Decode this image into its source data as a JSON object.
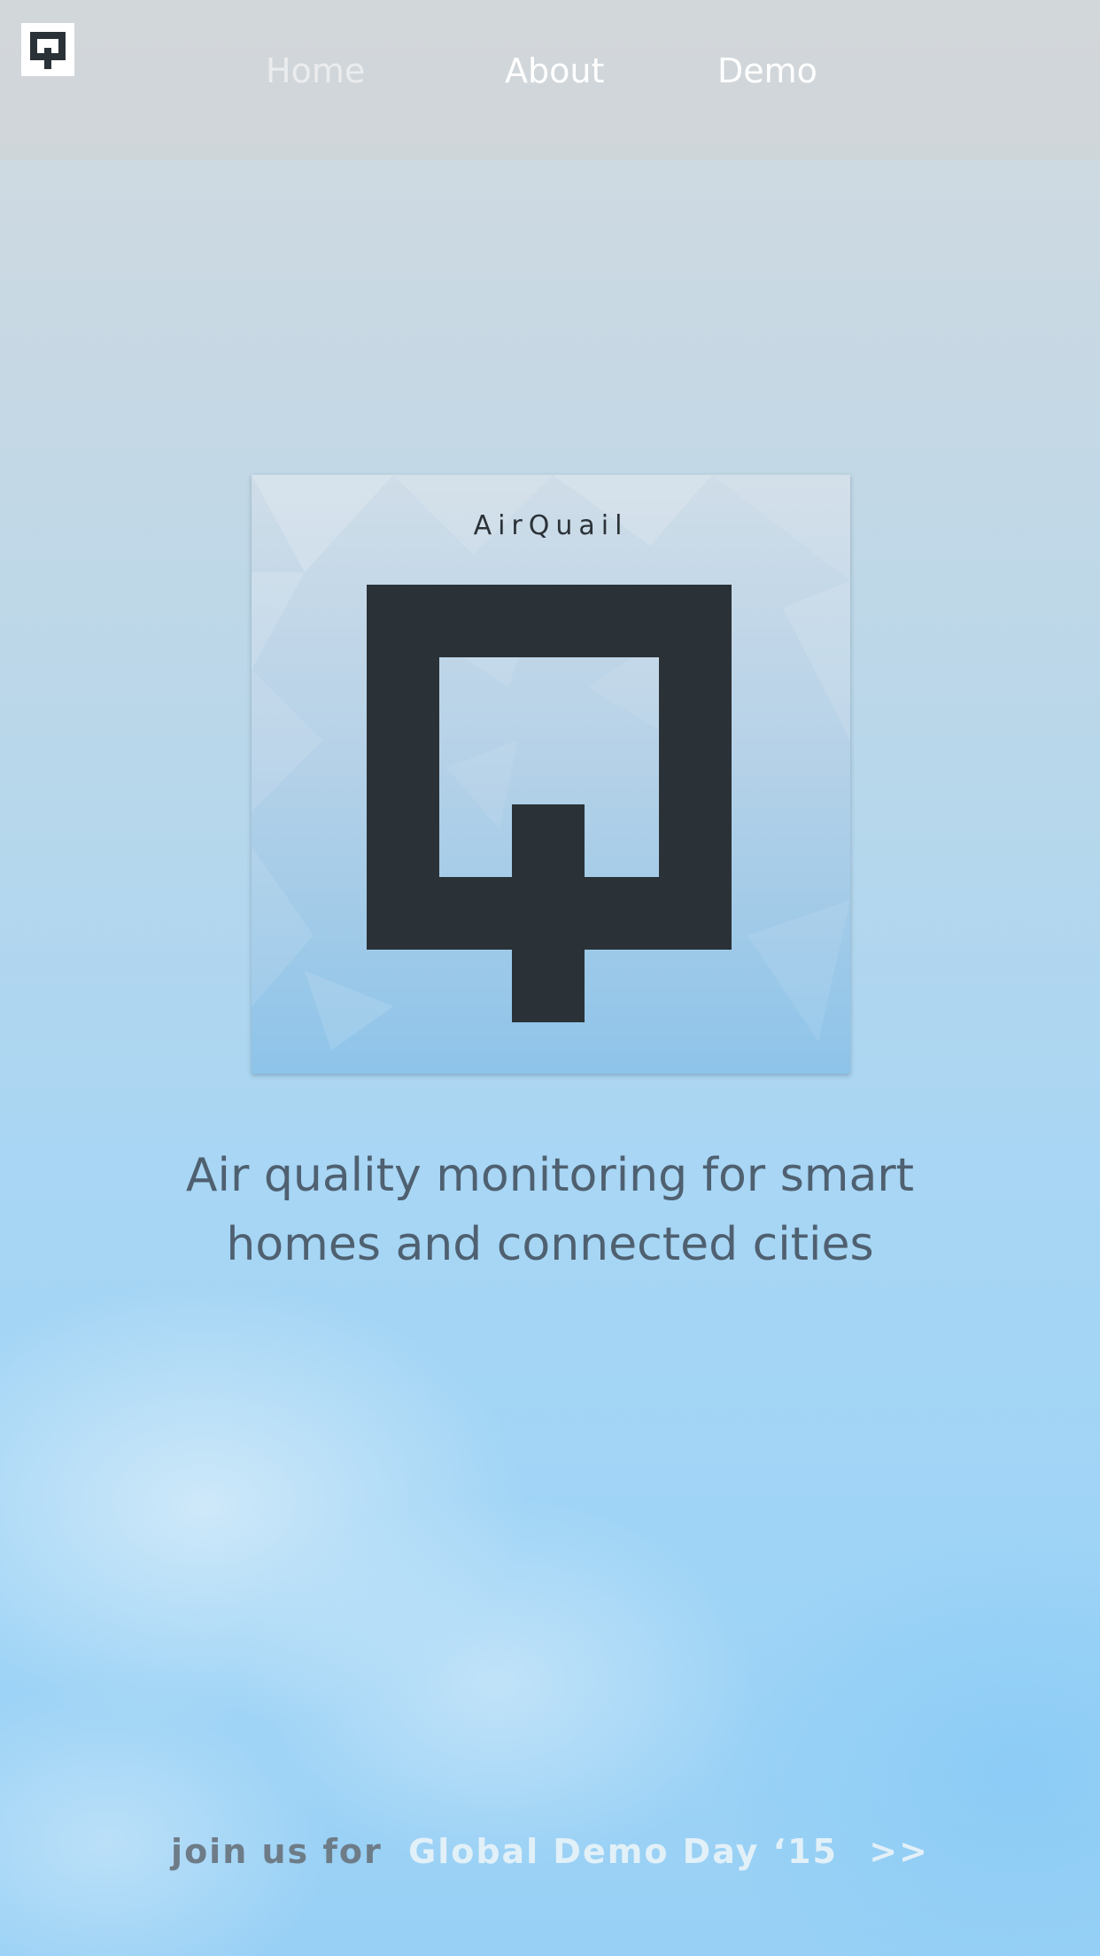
{
  "nav": {
    "logo_icon": "airquail-q-icon",
    "items": [
      {
        "label": "Home",
        "active": true
      },
      {
        "label": "About",
        "active": false
      },
      {
        "label": "Demo",
        "active": false
      }
    ]
  },
  "hero": {
    "brand_name": "AirQuail",
    "logo_icon": "airquail-q-logo"
  },
  "tagline": {
    "line1": "Air quality monitoring for smart",
    "line2": "homes and connected cities"
  },
  "cta": {
    "prefix": "join us for",
    "link": "Global Demo Day ‘15",
    "arrow": ">>"
  },
  "colors": {
    "logo_dark": "#2b3237",
    "tagline_text": "#4f6070",
    "cta_prefix": "#6e7c88",
    "cta_link": "#e2f0f8"
  }
}
